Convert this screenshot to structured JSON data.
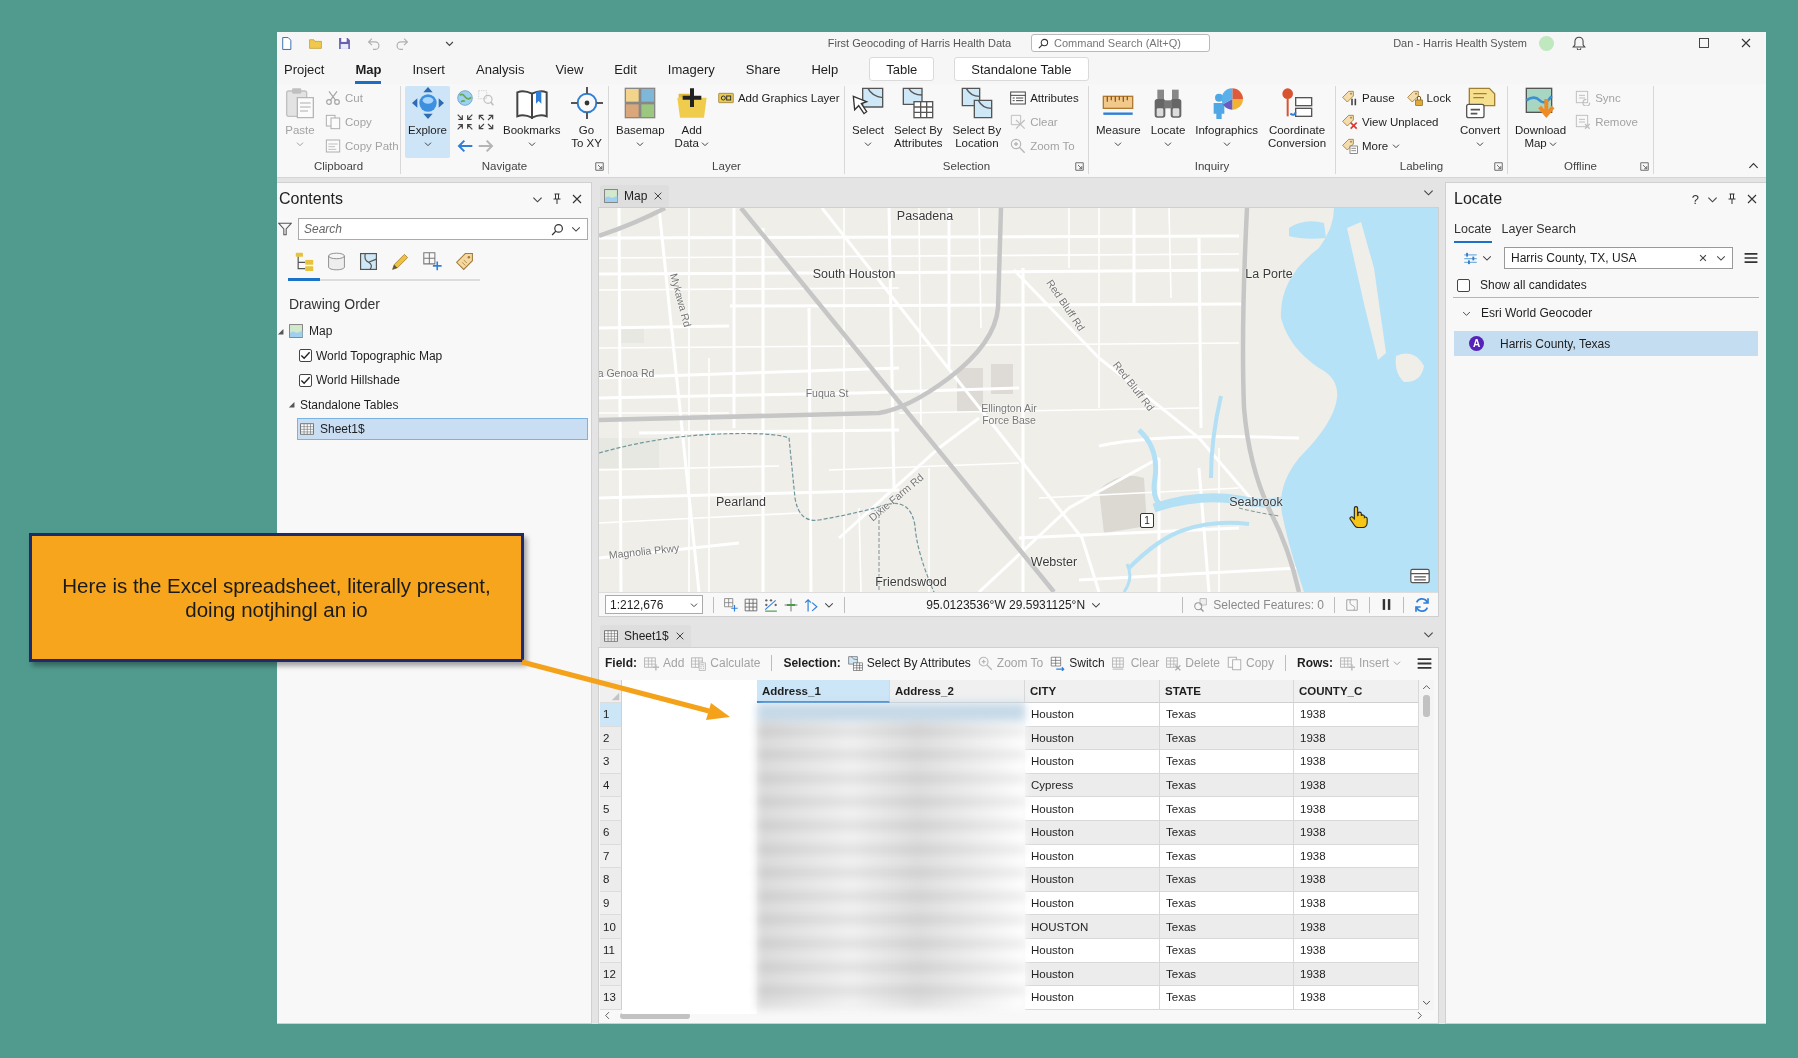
{
  "title_bar": {
    "title": "First Geocoding of Harris Health Data",
    "command_search": {
      "placeholder": "Command Search (Alt+Q)"
    },
    "user": "Dan - Harris Health System"
  },
  "ribbon": {
    "tabs": [
      {
        "label": "Project",
        "selected": false,
        "kind": "tab"
      },
      {
        "label": "Map",
        "selected": true,
        "kind": "tab"
      },
      {
        "label": "Insert",
        "selected": false,
        "kind": "tab"
      },
      {
        "label": "Analysis",
        "selected": false,
        "kind": "tab"
      },
      {
        "label": "View",
        "selected": false,
        "kind": "tab"
      },
      {
        "label": "Edit",
        "selected": false,
        "kind": "tab"
      },
      {
        "label": "Imagery",
        "selected": false,
        "kind": "tab"
      },
      {
        "label": "Share",
        "selected": false,
        "kind": "tab"
      },
      {
        "label": "Help",
        "selected": false,
        "kind": "tab"
      },
      {
        "label": "Table",
        "selected": false,
        "kind": "contextual"
      },
      {
        "label": "Standalone Table",
        "selected": false,
        "kind": "contextual"
      }
    ],
    "groups": [
      {
        "label": "Clipboard",
        "launcher": false,
        "items": [
          {
            "kind": "large",
            "lines": [
              "Paste"
            ],
            "disabled": true,
            "dropdown": true,
            "selected": false
          },
          {
            "kind": "stack",
            "rows": [
              [
                {
                  "label": "Cut",
                  "disabled": true,
                  "dropdown": false
                }
              ],
              [
                {
                  "label": "Copy",
                  "disabled": true,
                  "dropdown": false
                }
              ],
              [
                {
                  "label": "Copy Path",
                  "disabled": true,
                  "dropdown": false
                }
              ]
            ]
          }
        ]
      },
      {
        "label": "Navigate",
        "launcher": true,
        "items": [
          {
            "kind": "large",
            "lines": [
              "Explore"
            ],
            "disabled": false,
            "dropdown": true,
            "selected": true
          },
          {
            "kind": "icons",
            "icons": [
              {
                "disabled": false
              },
              {
                "disabled": true
              },
              {
                "disabled": false
              },
              {
                "disabled": false
              },
              {
                "disabled": false
              },
              {
                "disabled": true
              }
            ]
          },
          {
            "kind": "large",
            "lines": [
              "Bookmarks"
            ],
            "disabled": false,
            "dropdown": true,
            "selected": false
          },
          {
            "kind": "large",
            "lines": [
              "Go",
              "To XY"
            ],
            "disabled": false,
            "dropdown": false,
            "selected": false
          }
        ]
      },
      {
        "label": "Layer",
        "launcher": false,
        "items": [
          {
            "kind": "large",
            "lines": [
              "Basemap"
            ],
            "disabled": false,
            "dropdown": true,
            "selected": false
          },
          {
            "kind": "large",
            "lines": [
              "Add",
              "Data"
            ],
            "disabled": false,
            "dropdown": true,
            "selected": false
          },
          {
            "kind": "stack",
            "rows": [
              [
                {
                  "label": "Add Graphics Layer",
                  "disabled": false,
                  "dropdown": false
                }
              ]
            ]
          }
        ]
      },
      {
        "label": "Selection",
        "launcher": true,
        "items": [
          {
            "kind": "large",
            "lines": [
              "Select"
            ],
            "disabled": false,
            "dropdown": true,
            "selected": false
          },
          {
            "kind": "large",
            "lines": [
              "Select By",
              "Attributes"
            ],
            "disabled": false,
            "dropdown": false,
            "selected": false
          },
          {
            "kind": "large",
            "lines": [
              "Select By",
              "Location"
            ],
            "disabled": false,
            "dropdown": false,
            "selected": false
          },
          {
            "kind": "stack",
            "rows": [
              [
                {
                  "label": "Attributes",
                  "disabled": false,
                  "dropdown": false
                }
              ],
              [
                {
                  "label": "Clear",
                  "disabled": true,
                  "dropdown": false
                }
              ],
              [
                {
                  "label": "Zoom To",
                  "disabled": true,
                  "dropdown": false
                }
              ]
            ]
          }
        ]
      },
      {
        "label": "Inquiry",
        "launcher": false,
        "items": [
          {
            "kind": "large",
            "lines": [
              "Measure"
            ],
            "disabled": false,
            "dropdown": true,
            "selected": false
          },
          {
            "kind": "large",
            "lines": [
              "Locate"
            ],
            "disabled": false,
            "dropdown": true,
            "selected": false
          },
          {
            "kind": "large",
            "lines": [
              "Infographics"
            ],
            "disabled": false,
            "dropdown": true,
            "selected": false
          },
          {
            "kind": "large",
            "lines": [
              "Coordinate",
              "Conversion"
            ],
            "disabled": false,
            "dropdown": false,
            "selected": false
          }
        ]
      },
      {
        "label": "Labeling",
        "launcher": true,
        "items": [
          {
            "kind": "stack",
            "rows": [
              [
                {
                  "label": "Pause",
                  "disabled": false,
                  "dropdown": false
                },
                {
                  "label": "Lock",
                  "disabled": false,
                  "dropdown": false
                }
              ],
              [
                {
                  "label": "View Unplaced",
                  "disabled": false,
                  "dropdown": false
                }
              ],
              [
                {
                  "label": "More",
                  "disabled": false,
                  "dropdown": true
                }
              ]
            ]
          },
          {
            "kind": "large",
            "lines": [
              "Convert"
            ],
            "disabled": false,
            "dropdown": true,
            "selected": false
          }
        ]
      },
      {
        "label": "Offline",
        "launcher": true,
        "items": [
          {
            "kind": "large",
            "lines": [
              "Download",
              "Map"
            ],
            "disabled": false,
            "dropdown": true,
            "selected": false
          },
          {
            "kind": "stack",
            "rows": [
              [
                {
                  "label": "Sync",
                  "disabled": true,
                  "dropdown": false
                }
              ],
              [
                {
                  "label": "Remove",
                  "disabled": true,
                  "dropdown": false
                }
              ]
            ]
          }
        ]
      }
    ]
  },
  "contents": {
    "title": "Contents",
    "search": {
      "placeholder": "Search"
    },
    "view_tabs": [
      {
        "selected": true
      },
      {
        "selected": false
      },
      {
        "selected": false
      },
      {
        "selected": false
      },
      {
        "selected": false
      },
      {
        "selected": false
      }
    ],
    "heading": "Drawing Order",
    "tree": [
      {
        "label": "Map",
        "kind": "map",
        "expanded": true,
        "selected": false,
        "children": [
          {
            "label": "World Topographic Map",
            "kind": "layer",
            "checked": true,
            "selected": false
          },
          {
            "label": "World Hillshade",
            "kind": "layer",
            "checked": true,
            "selected": false
          },
          {
            "label": "Standalone Tables",
            "kind": "folder",
            "expanded": true,
            "selected": false,
            "children": [
              {
                "label": "Sheet1$",
                "kind": "table",
                "selected": true
              }
            ]
          }
        ]
      }
    ]
  },
  "map_view": {
    "tab": {
      "label": "Map"
    },
    "labels": [
      {
        "text": "Pasadena",
        "kind": "place"
      },
      {
        "text": "South Houston",
        "kind": "place"
      },
      {
        "text": "La Porte",
        "kind": "place"
      },
      {
        "text": "Mykawa Rd",
        "kind": "road"
      },
      {
        "text": "Red Bluff Rd",
        "kind": "road"
      },
      {
        "text": "a Genoa Rd",
        "kind": "road"
      },
      {
        "text": "Red Bluff Rd",
        "kind": "road"
      },
      {
        "text": "Fuqua St",
        "kind": "road"
      },
      {
        "text": "Ellington Air Force Base",
        "kind": "landmark"
      },
      {
        "text": "Pearland",
        "kind": "place"
      },
      {
        "text": "Dixie Farm Rd",
        "kind": "road"
      },
      {
        "text": "Seabrook",
        "kind": "place"
      },
      {
        "text": "Magnolia Pkwy",
        "kind": "road"
      },
      {
        "text": "Webster",
        "kind": "place"
      },
      {
        "text": "Friendswood",
        "kind": "place"
      }
    ],
    "route_shield": "1",
    "status_bar": {
      "scale": "1:212,676",
      "coordinates": "95.0123536°W 29.5931125°N",
      "selected_features": "Selected Features: 0"
    }
  },
  "table_view": {
    "tab": {
      "label": "Sheet1$"
    },
    "toolbar": [
      {
        "label": "Field:",
        "buttons": [
          {
            "label": "Add",
            "disabled": true,
            "dropdown": false
          },
          {
            "label": "Calculate",
            "disabled": true,
            "dropdown": false
          }
        ]
      },
      {
        "label": "Selection:",
        "buttons": [
          {
            "label": "Select By Attributes",
            "disabled": false,
            "dropdown": false
          },
          {
            "label": "Zoom To",
            "disabled": true,
            "dropdown": false
          },
          {
            "label": "Switch",
            "disabled": false,
            "dropdown": false
          },
          {
            "label": "Clear",
            "disabled": true,
            "dropdown": false
          },
          {
            "label": "Delete",
            "disabled": true,
            "dropdown": false
          },
          {
            "label": "Copy",
            "disabled": true,
            "dropdown": false
          }
        ]
      },
      {
        "label": "Rows:",
        "buttons": [
          {
            "label": "Insert",
            "disabled": true,
            "dropdown": true
          }
        ]
      }
    ],
    "columns": [
      {
        "label": "Address_1",
        "selected": true,
        "blurred": true
      },
      {
        "label": "Address_2",
        "selected": false,
        "blurred": true
      },
      {
        "label": "CITY",
        "selected": false,
        "blurred": false
      },
      {
        "label": "STATE",
        "selected": false,
        "blurred": false
      },
      {
        "label": "COUNTY_C",
        "selected": false,
        "blurred": false
      }
    ],
    "rows": [
      {
        "number": "1",
        "selected": true,
        "cells": [
          "",
          "",
          "Houston",
          "Texas",
          "1938"
        ]
      },
      {
        "number": "2",
        "selected": false,
        "cells": [
          "",
          "",
          "Houston",
          "Texas",
          "1938"
        ]
      },
      {
        "number": "3",
        "selected": false,
        "cells": [
          "",
          "",
          "Houston",
          "Texas",
          "1938"
        ]
      },
      {
        "number": "4",
        "selected": false,
        "cells": [
          "",
          "",
          "Cypress",
          "Texas",
          "1938"
        ]
      },
      {
        "number": "5",
        "selected": false,
        "cells": [
          "",
          "",
          "Houston",
          "Texas",
          "1938"
        ]
      },
      {
        "number": "6",
        "selected": false,
        "cells": [
          "",
          "",
          "Houston",
          "Texas",
          "1938"
        ]
      },
      {
        "number": "7",
        "selected": false,
        "cells": [
          "",
          "",
          "Houston",
          "Texas",
          "1938"
        ]
      },
      {
        "number": "8",
        "selected": false,
        "cells": [
          "",
          "",
          "Houston",
          "Texas",
          "1938"
        ]
      },
      {
        "number": "9",
        "selected": false,
        "cells": [
          "",
          "",
          "Houston",
          "Texas",
          "1938"
        ]
      },
      {
        "number": "10",
        "selected": false,
        "cells": [
          "",
          "",
          "HOUSTON",
          "Texas",
          "1938"
        ]
      },
      {
        "number": "11",
        "selected": false,
        "cells": [
          "",
          "",
          "Houston",
          "Texas",
          "1938"
        ]
      },
      {
        "number": "12",
        "selected": false,
        "cells": [
          "",
          "",
          "Houston",
          "Texas",
          "1938"
        ]
      },
      {
        "number": "13",
        "selected": false,
        "cells": [
          "",
          "",
          "Houston",
          "Texas",
          "1938"
        ]
      }
    ]
  },
  "locate": {
    "title": "Locate",
    "help": "?",
    "tabs": [
      {
        "label": "Locate",
        "selected": true
      },
      {
        "label": "Layer Search",
        "selected": false
      }
    ],
    "search": {
      "value": "Harris County, TX, USA"
    },
    "show_all_candidates": {
      "label": "Show all candidates",
      "checked": false
    },
    "results": [
      {
        "label": "Esri World Geocoder",
        "expanded": true,
        "children": [
          {
            "badge": "A",
            "label": "Harris County, Texas",
            "selected": true
          }
        ]
      }
    ]
  },
  "callout": {
    "text": "Here is the Excel spreadsheet, literally present, doing notjhingl an io"
  }
}
